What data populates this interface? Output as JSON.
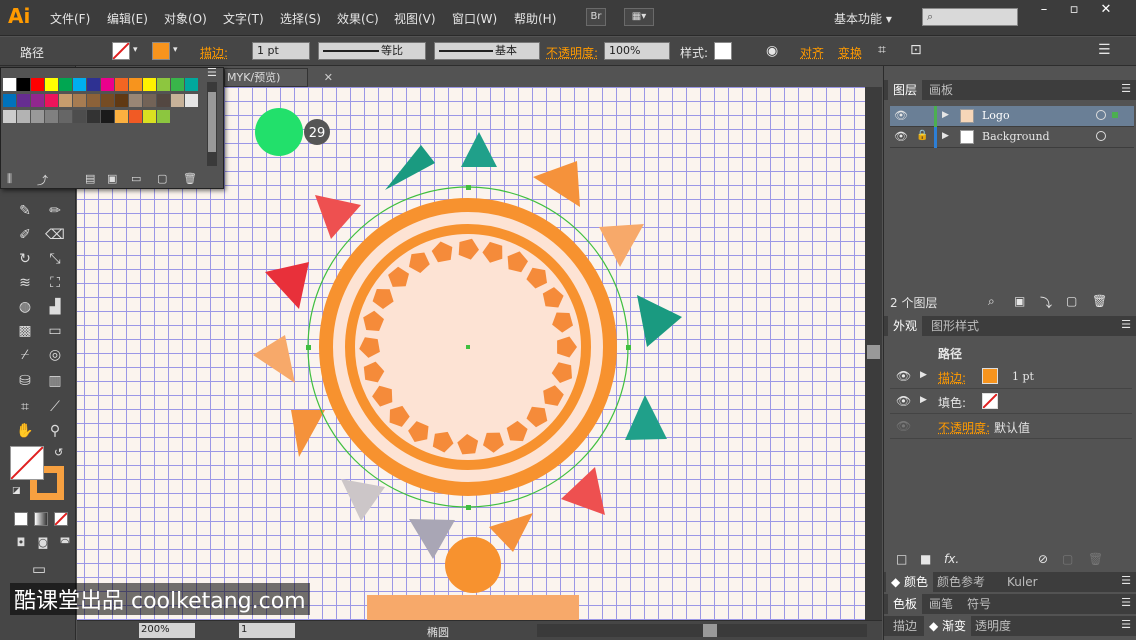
{
  "app": {
    "logo": "Ai"
  },
  "menus": [
    "文件(F)",
    "编辑(E)",
    "对象(O)",
    "文字(T)",
    "选择(S)",
    "效果(C)",
    "视图(V)",
    "窗口(W)",
    "帮助(H)"
  ],
  "bridge_label": "Br",
  "workspace": "基本功能",
  "search_placeholder": "",
  "control": {
    "object_type": "路径",
    "stroke_label": "描边:",
    "stroke_weight": "1 pt",
    "profile_label": "等比",
    "brush_label": "基本",
    "opacity_label": "不透明度:",
    "opacity_value": "100%",
    "style_label": "样式:",
    "align_label": "对齐",
    "transform_label": "变换"
  },
  "doc_tab": "MYK/预览)",
  "colors": {
    "accent": "#ff9a00",
    "selection": "#3fbf3f",
    "grid": "#9b97e6",
    "artboard": "#fbf4ee"
  },
  "canvas": {
    "badge_number": "29"
  },
  "status": {
    "zoom": "200%",
    "page": "1",
    "tool_name": "椭圆"
  },
  "layers": {
    "tabs": [
      "图层",
      "画板"
    ],
    "items": [
      {
        "name": "Logo",
        "color": "#4caf50",
        "selected": true
      },
      {
        "name": "Background",
        "color": "#2d7fd6",
        "selected": false
      }
    ],
    "count_label": "2 个图层"
  },
  "appearance": {
    "tabs": [
      "外观",
      "图形样式"
    ],
    "title": "路径",
    "stroke_label": "描边:",
    "stroke_value": "1 pt",
    "fill_label": "填色:",
    "opacity_label": "不透明度:",
    "opacity_value": "默认值"
  },
  "panel_groups": [
    [
      "颜色",
      "颜色参考",
      "Kuler"
    ],
    [
      "色板",
      "画笔",
      "符号"
    ],
    [
      "描边",
      "渐变",
      "透明度"
    ]
  ],
  "watermark": "酷课堂出品 coolketang.com"
}
